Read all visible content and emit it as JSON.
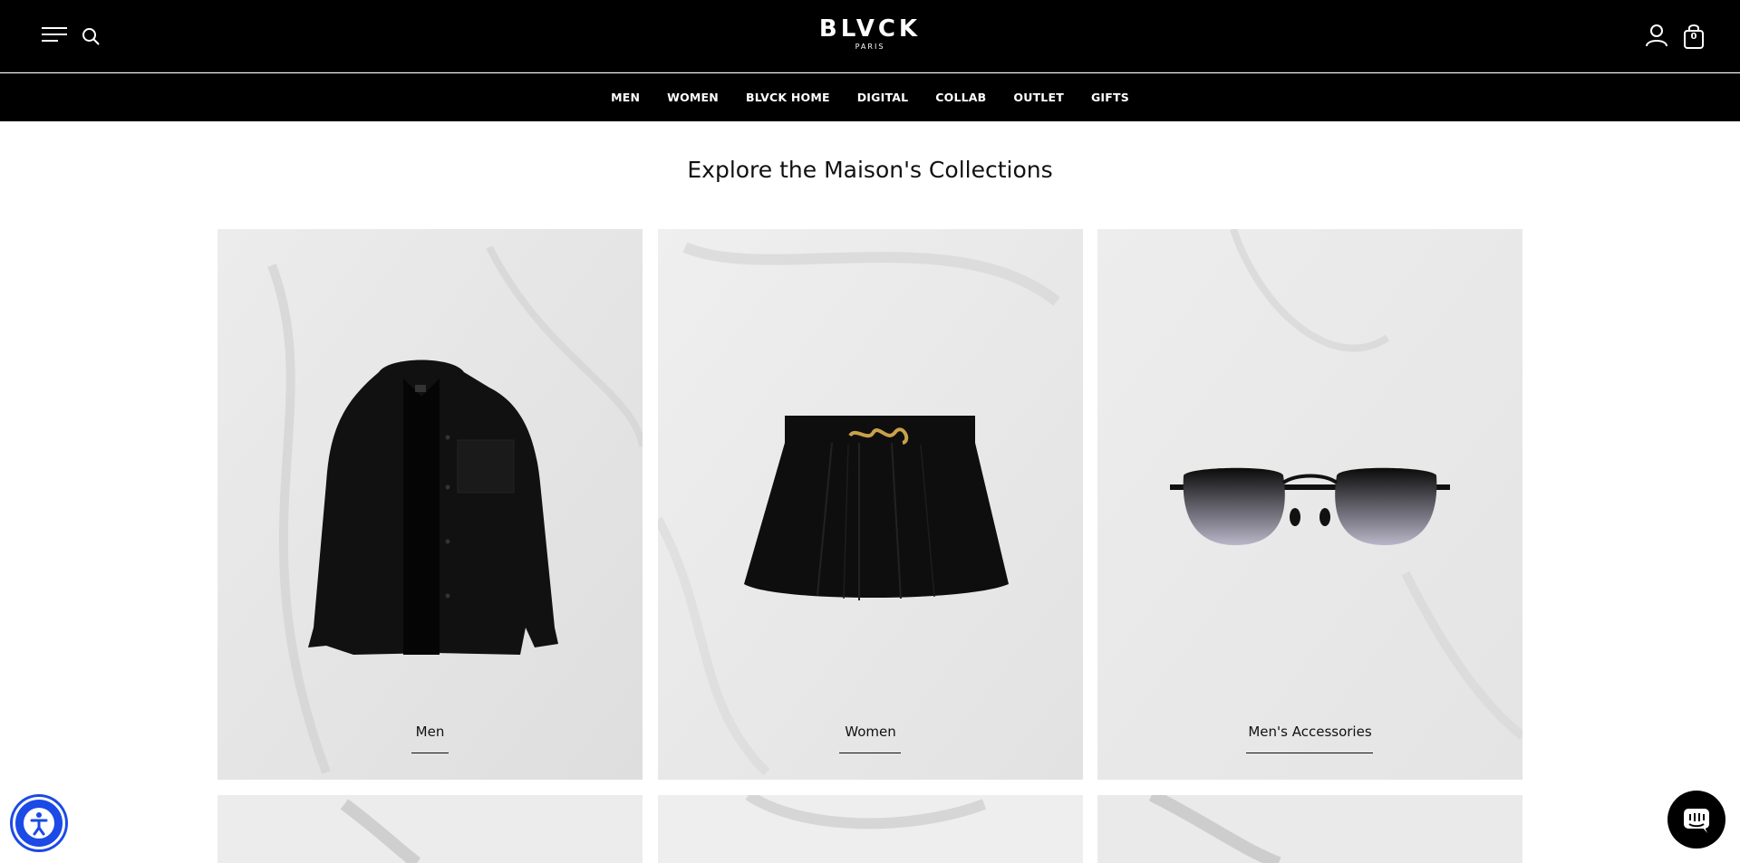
{
  "header": {
    "logo": "BLVCK",
    "logo_sub": "PARIS",
    "cart_count": "0",
    "icons": {
      "menu": "hamburger-menu-icon",
      "search": "search-icon",
      "account": "user-icon",
      "cart": "shopping-bag-icon"
    }
  },
  "nav": {
    "items": [
      {
        "label": "MEN"
      },
      {
        "label": "WOMEN"
      },
      {
        "label": "BLVCK HOME"
      },
      {
        "label": "DIGITAL"
      },
      {
        "label": "COLLAB"
      },
      {
        "label": "OUTLET"
      },
      {
        "label": "GIFTS"
      }
    ]
  },
  "main": {
    "title": "Explore the Maison's Collections",
    "collections": [
      {
        "label": "Men",
        "image": "black-jacket"
      },
      {
        "label": "Women",
        "image": "black-pleated-skirt"
      },
      {
        "label": "Men's Accessories",
        "image": "black-rimless-sunglasses"
      }
    ]
  },
  "colors": {
    "header_bg": "#000000",
    "page_bg": "#ffffff",
    "card_bg": "#e6e6e6",
    "accessibility": "#1b4ae6"
  },
  "floating": {
    "accessibility_icon": "accessibility-icon",
    "chat_icon": "chat-icon"
  }
}
